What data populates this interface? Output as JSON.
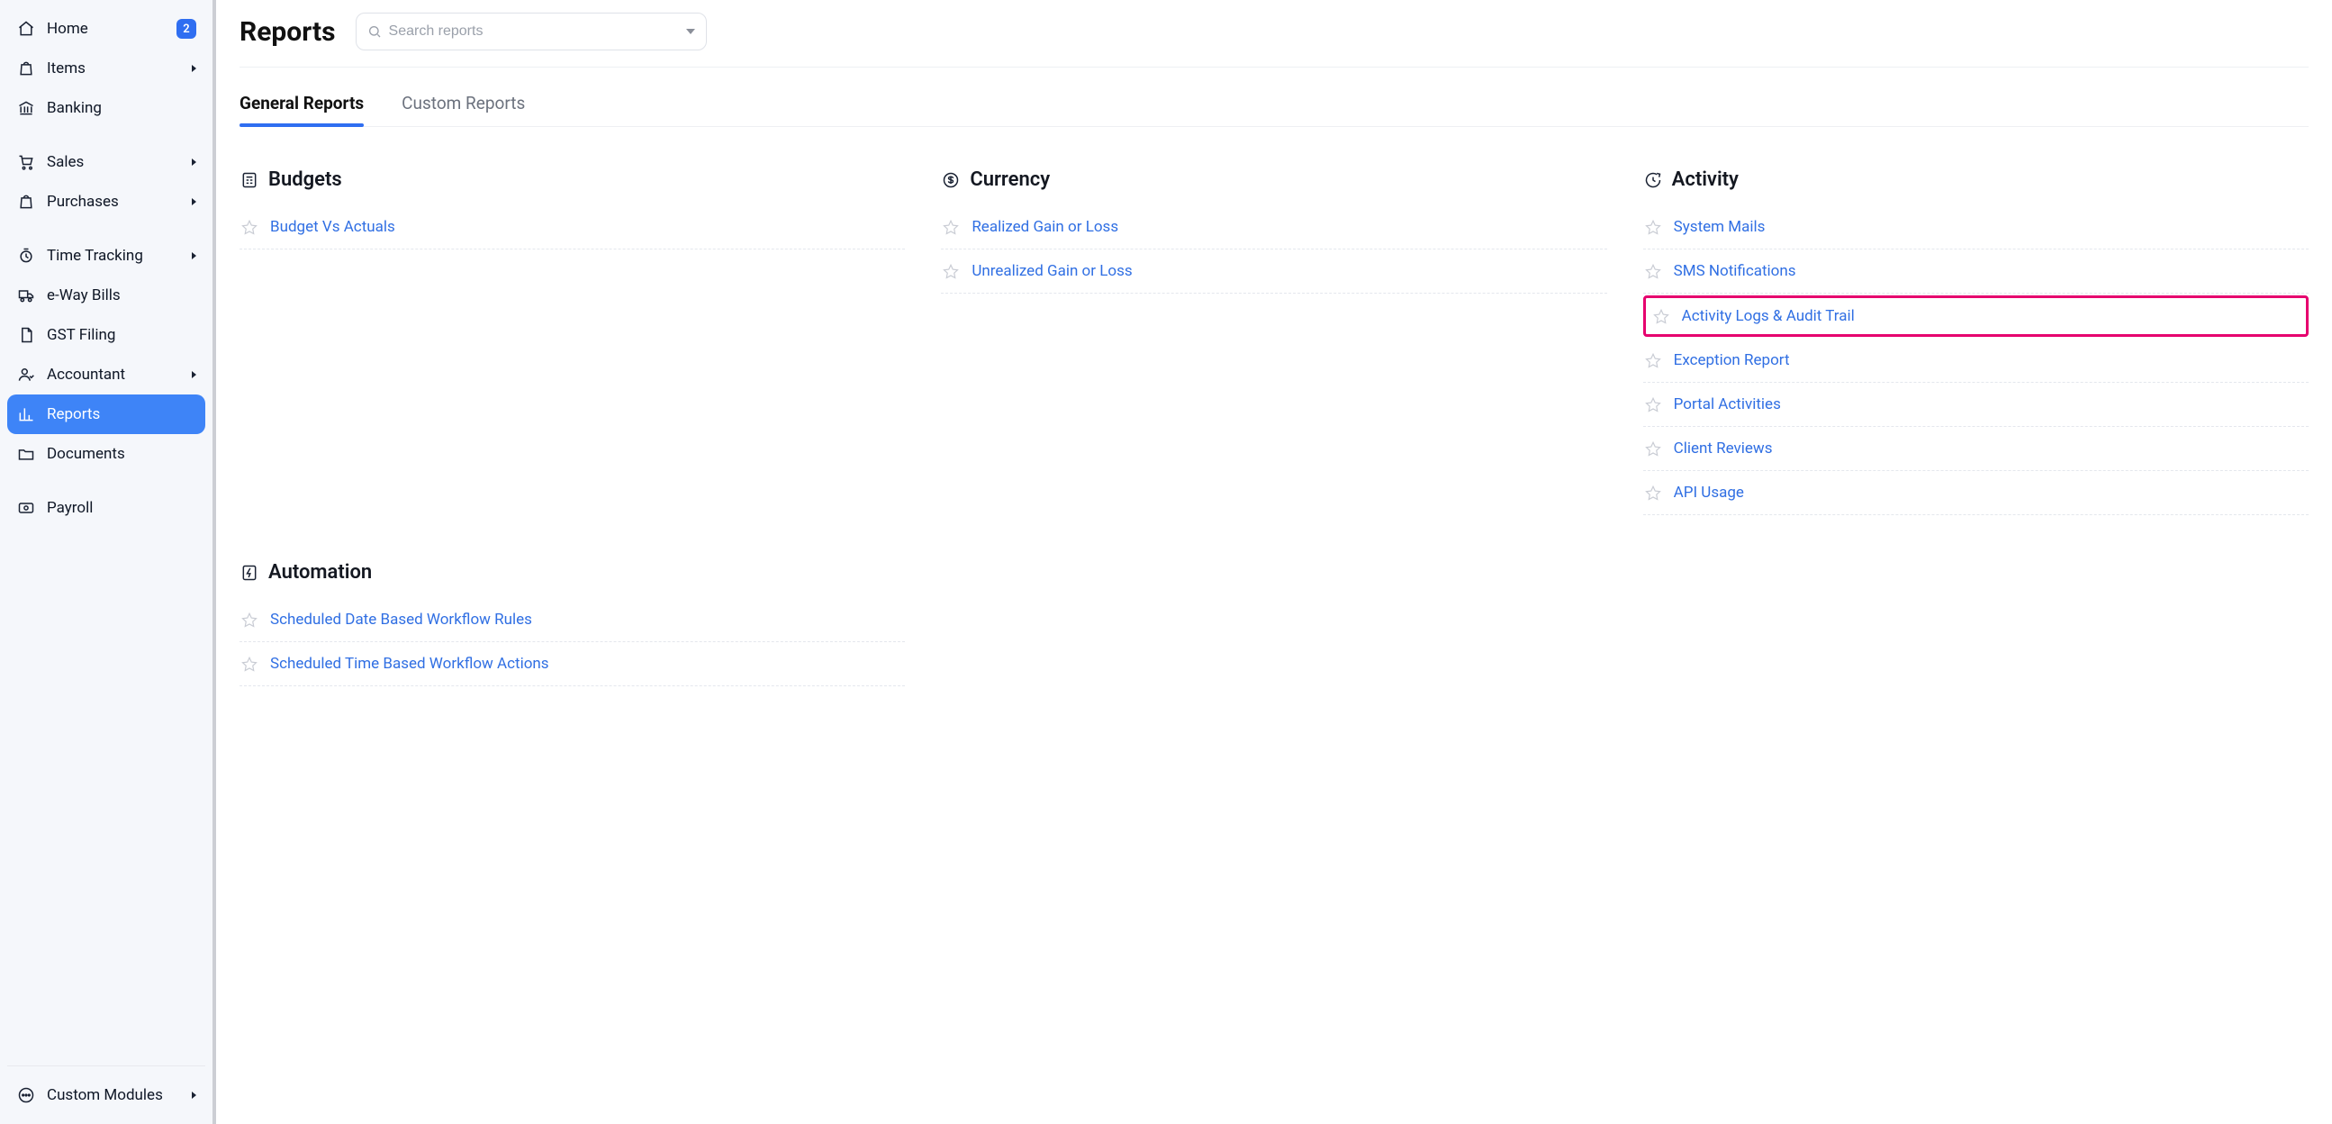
{
  "sidebar": {
    "items": [
      {
        "label": "Home",
        "badge": "2",
        "expandable": false
      },
      {
        "label": "Items",
        "expandable": true
      },
      {
        "label": "Banking",
        "expandable": false
      }
    ],
    "items2": [
      {
        "label": "Sales",
        "expandable": true
      },
      {
        "label": "Purchases",
        "expandable": true
      }
    ],
    "items3": [
      {
        "label": "Time Tracking",
        "expandable": true
      },
      {
        "label": "e-Way Bills",
        "expandable": false
      },
      {
        "label": "GST Filing",
        "expandable": false
      },
      {
        "label": "Accountant",
        "expandable": true
      },
      {
        "label": "Reports",
        "expandable": false,
        "active": true
      },
      {
        "label": "Documents",
        "expandable": false
      }
    ],
    "items4": [
      {
        "label": "Payroll",
        "expandable": false
      }
    ],
    "bottom": {
      "label": "Custom Modules",
      "expandable": true
    }
  },
  "page": {
    "title": "Reports",
    "search_placeholder": "Search reports"
  },
  "tabs": {
    "general": "General Reports",
    "custom": "Custom Reports"
  },
  "columns": {
    "budgets": {
      "title": "Budgets",
      "items": [
        "Budget Vs Actuals"
      ]
    },
    "automation": {
      "title": "Automation",
      "items": [
        "Scheduled Date Based Workflow Rules",
        "Scheduled Time Based Workflow Actions"
      ]
    },
    "currency": {
      "title": "Currency",
      "items": [
        "Realized Gain or Loss",
        "Unrealized Gain or Loss"
      ]
    },
    "activity": {
      "title": "Activity",
      "items": [
        "System Mails",
        "SMS Notifications",
        "Activity Logs & Audit Trail",
        "Exception Report",
        "Portal Activities",
        "Client Reviews",
        "API Usage"
      ],
      "highlight_index": 2
    }
  }
}
